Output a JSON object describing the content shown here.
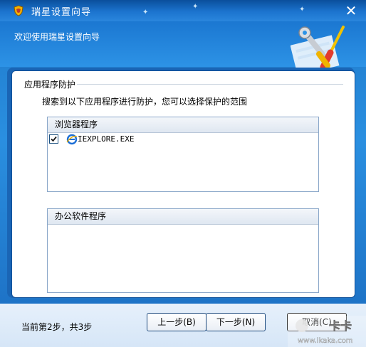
{
  "window": {
    "title": "瑞星设置向导",
    "close_glyph": "✕"
  },
  "header": {
    "welcome": "欢迎使用瑞星设置向导"
  },
  "content": {
    "group_title": "应用程序防护",
    "instruction": "搜索到以下应用程序进行防护，您可以选择保护的范围",
    "browser_list": {
      "header": "浏览器程序",
      "items": [
        {
          "label": "IEXPLORE.EXE",
          "checked": true,
          "icon": "ie-icon"
        }
      ]
    },
    "office_list": {
      "header": "办公软件程序",
      "items": []
    }
  },
  "footer": {
    "step_status": "当前第2步，共3步",
    "prev_label": "上一步(B)",
    "next_label": "下一步(N)",
    "cancel_label": "取消(C)"
  },
  "watermark": {
    "logo_text": "卡卡",
    "url": "www.ikaka.com"
  },
  "colors": {
    "title_blue": "#0a4f9c",
    "header_blue": "#2d93e6",
    "panel_border": "#0f4f98",
    "footer_bg": "#e6f0fb"
  }
}
